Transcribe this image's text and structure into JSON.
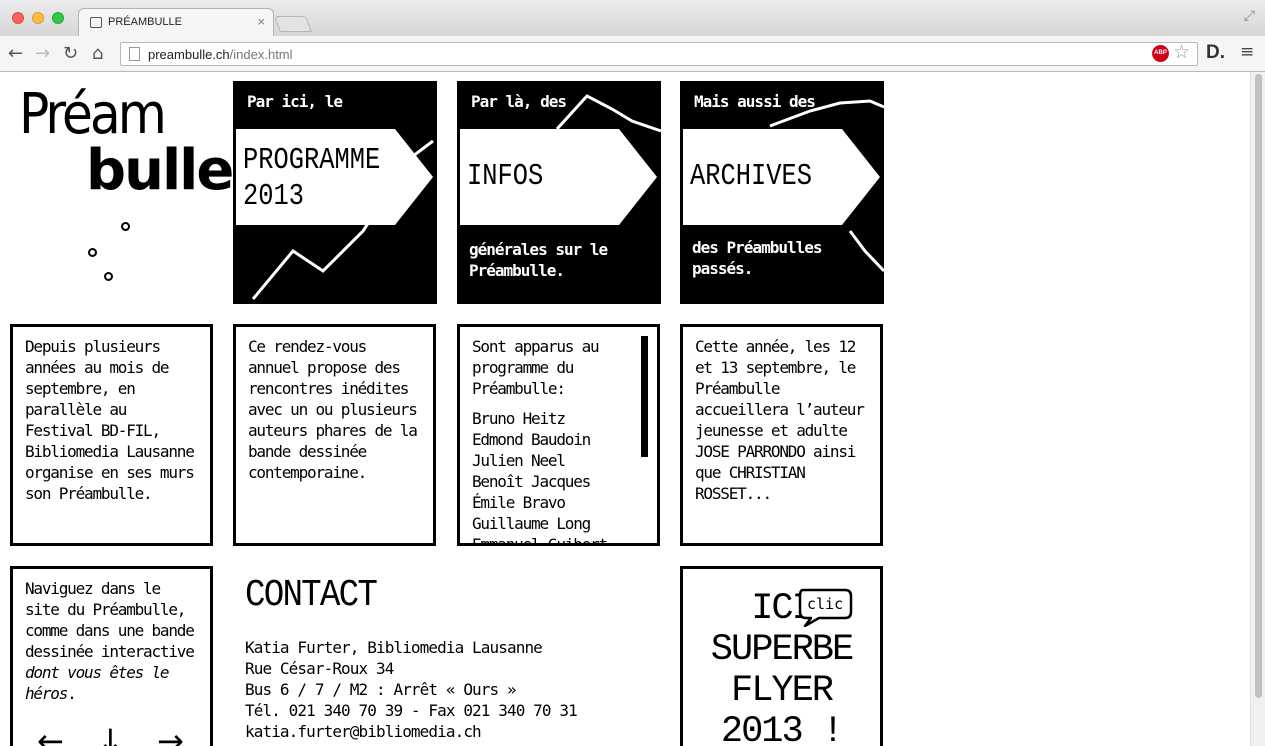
{
  "browser": {
    "tab_title": "PRÉAMBULLE",
    "tab_close": "×",
    "url_host": "preambulle.ch",
    "url_path": "/index.html",
    "abp_label": "ABP",
    "icons": {
      "back": "←",
      "forward": "→",
      "reload": "↻",
      "home": "⌂",
      "star": "☆",
      "menu": "≡",
      "fullscreen": "⤢",
      "extension": "D."
    }
  },
  "logo": {
    "line1": "Préam",
    "line2": "bulle"
  },
  "tiles": [
    {
      "top": "Par ici, le",
      "big_line1": "PROGRAMME",
      "big_line2": "2013",
      "bottom_line1": "",
      "bottom_line2": ""
    },
    {
      "top": "Par là, des",
      "big_line1": "INFOS",
      "big_line2": "",
      "bottom_line1": "générales sur le",
      "bottom_line2": "Préambulle."
    },
    {
      "top": "Mais aussi des",
      "big_line1": "ARCHIVES",
      "big_line2": "",
      "bottom_line1": "des Préambulles",
      "bottom_line2": "passés."
    }
  ],
  "boxes": {
    "intro": "Depuis plusieurs années au mois de septembre, en parallèle au Festival BD-FIL, Bibliomedia Lausanne organise en ses murs son Préambulle.",
    "concept": "Ce rendez-vous annuel propose des rencontres inédites avec un ou plusieurs auteurs phares de la bande dessinée contemporaine.",
    "authors_intro": "Sont apparus au programme du Préambulle:",
    "authors": [
      "Bruno Heitz",
      "Edmond Baudoin",
      "Julien Neel",
      "Benoît Jacques",
      "Émile Bravo",
      "Guillaume Long",
      "Emmanuel Guibert"
    ],
    "this_year": "Cette année, les 12 et 13 septembre, le Préambulle accueillera l’auteur jeunesse et adulte JOSE PARRONDO ainsi que CHRISTIAN ROSSET...",
    "navigate_text": "Naviguez dans le site du Préambulle, comme dans une bande dessinée interactive ",
    "navigate_italic": "dont vous êtes le héros",
    "navigate_end": "."
  },
  "nav_arrows": {
    "left": "←",
    "down": "↓",
    "right": "→"
  },
  "contact": {
    "title": "CONTACT",
    "lines": [
      "Katia Furter, Bibliomedia Lausanne",
      "Rue César-Roux 34",
      "Bus 6 / 7 / M2 : Arrêt « Ours »",
      "Tél. 021 340 70 39 - Fax 021 340 70 31",
      "katia.furter@bibliomedia.ch"
    ]
  },
  "flyer": {
    "bubble": "clic",
    "lines": [
      "ICI",
      "SUPERBE",
      "FLYER",
      "2013 !"
    ]
  }
}
